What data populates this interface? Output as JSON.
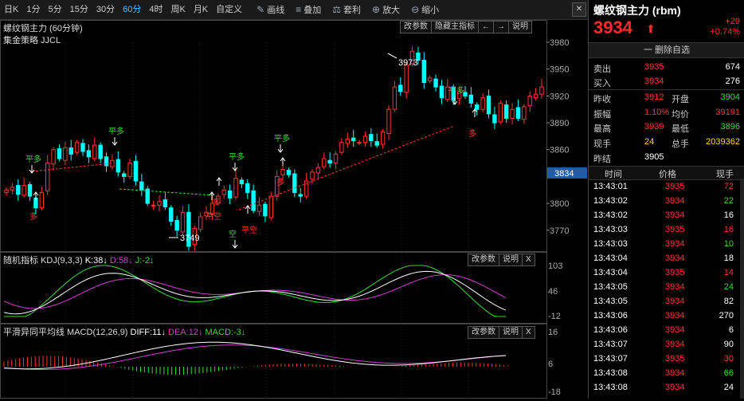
{
  "toolbar": {
    "timeframes": [
      "日K",
      "1分",
      "5分",
      "15分",
      "30分",
      "60分",
      "4时",
      "周K",
      "月K",
      "自定义"
    ],
    "active_timeframe": "60分",
    "tools": [
      {
        "label": "画线",
        "icon": "pencil-icon"
      },
      {
        "label": "叠加",
        "icon": "stack-icon"
      },
      {
        "label": "套利",
        "icon": "arbitrage-icon"
      },
      {
        "label": "放大",
        "icon": "zoom-in-icon"
      },
      {
        "label": "缩小",
        "icon": "zoom-out-icon"
      }
    ],
    "close_label": "✕"
  },
  "main_panel": {
    "title": "螺纹钢主力 (60分钟)",
    "strategy": "集金策略 JJCL",
    "buttons": [
      "改参数",
      "隐藏主指标",
      "←",
      "→",
      "说明"
    ],
    "y_ticks": [
      "3980",
      "3950",
      "3920",
      "3890",
      "3860",
      "3834",
      "3800",
      "3770"
    ],
    "current_price_tag": "3834",
    "high_label": "3973",
    "low_label": "3749"
  },
  "kdj_panel": {
    "title": "随机指标 KDJ(9,3,3)",
    "k": "K:38↓",
    "d": "D:58↓",
    "j": "J:-2↓",
    "buttons": [
      "改参数",
      "说明",
      "X"
    ],
    "y_ticks": [
      "103",
      "46",
      "-12"
    ]
  },
  "macd_panel": {
    "title": "平滑异同平均线 MACD(12,26,9)",
    "diff": "DIFF:11↓",
    "dea": "DEA:12↓",
    "macd": "MACD:-3↓",
    "buttons": [
      "改参数",
      "说明",
      "X"
    ],
    "y_ticks": [
      "16",
      "6",
      "-18"
    ]
  },
  "quote": {
    "title": "螺纹钢主力 (rbm)",
    "price": "3934",
    "change": "+29",
    "change_pct": "+0.74%",
    "delete_label": "一 删除自选",
    "sell_label": "卖出",
    "sell_price": "3935",
    "sell_vol": "674",
    "buy_label": "买入",
    "buy_price": "3934",
    "buy_vol": "276",
    "rows": [
      {
        "l1": "昨收",
        "v1": "3912",
        "l2": "开盘",
        "v2": "3904",
        "c1": "red",
        "c2": "green"
      },
      {
        "l1": "振幅",
        "v1": "1.10%",
        "l2": "均价",
        "v2": "39191",
        "c1": "red",
        "c2": "red"
      },
      {
        "l1": "最高",
        "v1": "3939",
        "l2": "最低",
        "v2": "3896",
        "c1": "red",
        "c2": "green"
      },
      {
        "l1": "现手",
        "v1": "24",
        "l2": "总手",
        "v2": "2039362",
        "c1": "yellow",
        "c2": "yellow"
      }
    ],
    "settle_label": "昨结",
    "settle_value": "3905"
  },
  "ticks": {
    "headers": [
      "时间",
      "价格",
      "现手"
    ],
    "rows": [
      {
        "t": "13:43:01",
        "p": "3935",
        "v": "72",
        "pc": "red",
        "vc": "red"
      },
      {
        "t": "13:43:02",
        "p": "3934",
        "v": "22",
        "pc": "red",
        "vc": "green"
      },
      {
        "t": "13:43:02",
        "p": "3934",
        "v": "16",
        "pc": "red",
        "vc": "white"
      },
      {
        "t": "13:43:03",
        "p": "3935",
        "v": "16",
        "pc": "red",
        "vc": "red"
      },
      {
        "t": "13:43:03",
        "p": "3934",
        "v": "10",
        "pc": "red",
        "vc": "green"
      },
      {
        "t": "13:43:04",
        "p": "3934",
        "v": "18",
        "pc": "red",
        "vc": "white"
      },
      {
        "t": "13:43:04",
        "p": "3935",
        "v": "14",
        "pc": "red",
        "vc": "red"
      },
      {
        "t": "13:43:05",
        "p": "3934",
        "v": "24",
        "pc": "red",
        "vc": "green"
      },
      {
        "t": "13:43:05",
        "p": "3934",
        "v": "82",
        "pc": "red",
        "vc": "white"
      },
      {
        "t": "13:43:06",
        "p": "3934",
        "v": "270",
        "pc": "red",
        "vc": "white"
      },
      {
        "t": "13:43:06",
        "p": "3934",
        "v": "6",
        "pc": "red",
        "vc": "white"
      },
      {
        "t": "13:43:07",
        "p": "3934",
        "v": "90",
        "pc": "red",
        "vc": "white"
      },
      {
        "t": "13:43:07",
        "p": "3935",
        "v": "30",
        "pc": "red",
        "vc": "red"
      },
      {
        "t": "13:43:08",
        "p": "3934",
        "v": "66",
        "pc": "red",
        "vc": "green"
      },
      {
        "t": "13:43:08",
        "p": "3934",
        "v": "24",
        "pc": "red",
        "vc": "white"
      }
    ]
  },
  "signals": [
    {
      "text": "平多",
      "kind": "buy"
    },
    {
      "text": "多",
      "kind": "sell"
    },
    {
      "text": "平多",
      "kind": "buy"
    },
    {
      "text": "平空",
      "kind": "sell"
    },
    {
      "text": "多",
      "kind": "sell"
    },
    {
      "text": "平多",
      "kind": "buy"
    },
    {
      "text": "空",
      "kind": "buy"
    },
    {
      "text": "平空",
      "kind": "sell"
    },
    {
      "text": "平多",
      "kind": "buy"
    },
    {
      "text": "多",
      "kind": "sell"
    },
    {
      "text": "平多",
      "kind": "buy"
    },
    {
      "text": "多",
      "kind": "sell"
    }
  ],
  "colors": {
    "up": "#ff3232",
    "down": "#00ffff",
    "kdj_k": "#ffffff",
    "kdj_d": "#d040d0",
    "kdj_j": "#33dd33",
    "accent": "#4cc1ff"
  }
}
